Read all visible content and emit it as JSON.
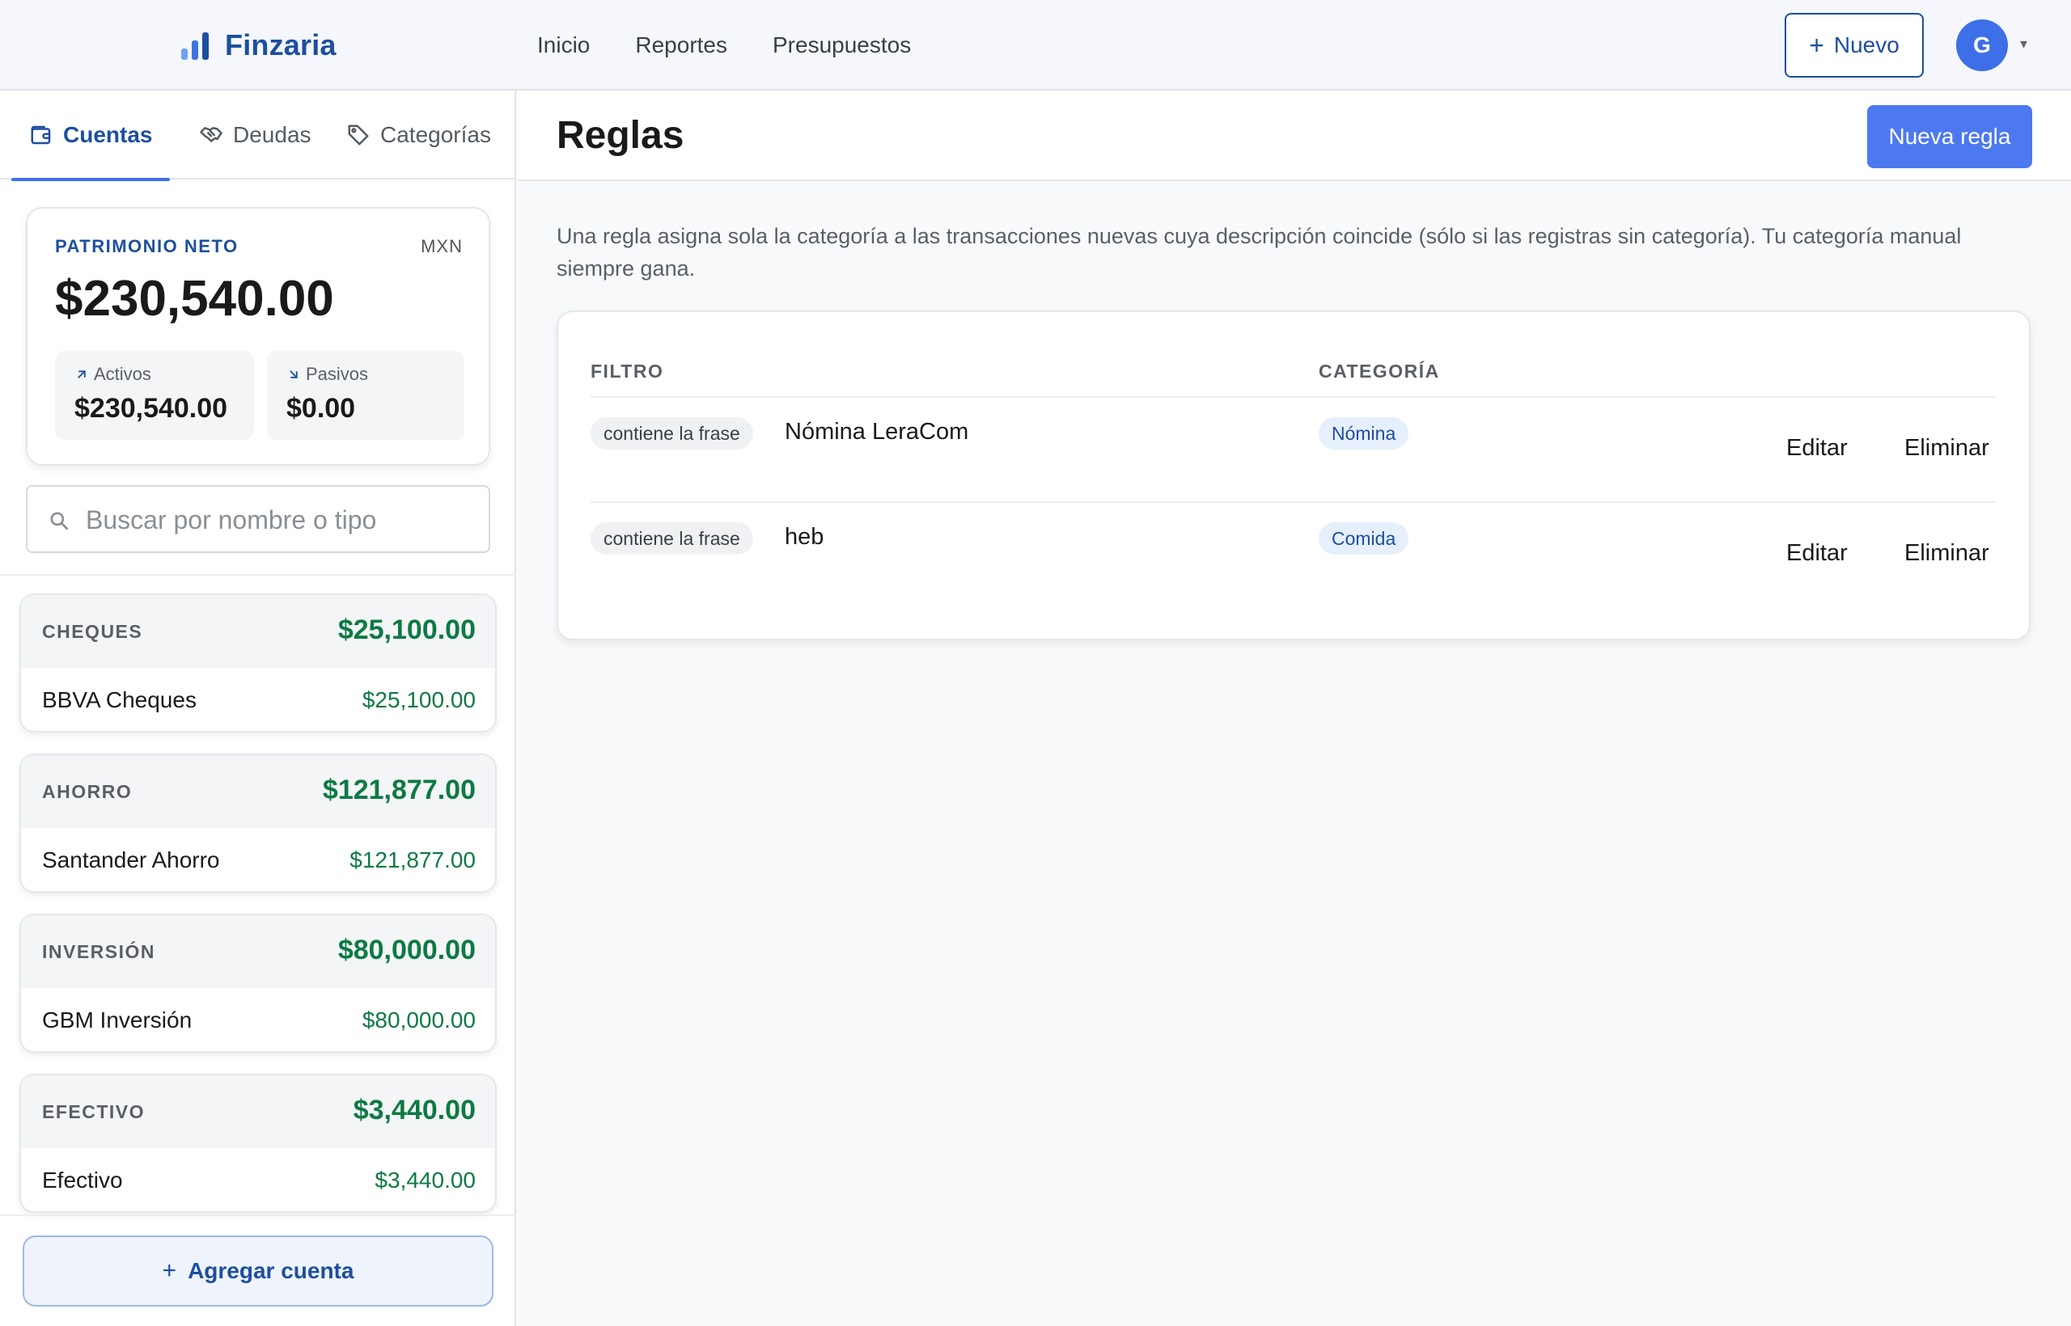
{
  "header": {
    "brand": "Finzaria",
    "nav": [
      "Inicio",
      "Reportes",
      "Presupuestos"
    ],
    "new_button": "Nuevo",
    "avatar_initial": "G"
  },
  "sidebar": {
    "tabs": [
      {
        "label": "Cuentas",
        "icon": "wallet-icon",
        "active": true
      },
      {
        "label": "Deudas",
        "icon": "handshake-icon",
        "active": false
      },
      {
        "label": "Categorías",
        "icon": "tag-icon",
        "active": false
      }
    ],
    "net_worth": {
      "label": "PATRIMONIO NETO",
      "currency": "MXN",
      "value": "$230,540.00",
      "assets_label": "Activos",
      "assets_value": "$230,540.00",
      "liabilities_label": "Pasivos",
      "liabilities_value": "$0.00"
    },
    "search_placeholder": "Buscar por nombre o tipo",
    "groups": [
      {
        "name": "CHEQUES",
        "total": "$25,100.00",
        "account": "BBVA Cheques",
        "account_value": "$25,100.00"
      },
      {
        "name": "AHORRO",
        "total": "$121,877.00",
        "account": "Santander Ahorro",
        "account_value": "$121,877.00"
      },
      {
        "name": "INVERSIÓN",
        "total": "$80,000.00",
        "account": "GBM Inversión",
        "account_value": "$80,000.00"
      },
      {
        "name": "EFECTIVO",
        "total": "$3,440.00",
        "account": "Efectivo",
        "account_value": "$3,440.00"
      }
    ],
    "add_account": "Agregar cuenta"
  },
  "main": {
    "title": "Reglas",
    "new_rule_button": "Nueva regla",
    "description": "Una regla asigna sola la categoría a las transacciones nuevas cuya descripción coincide (sólo si las registras sin categoría). Tu categoría manual siempre gana.",
    "table": {
      "headers": {
        "filter": "FILTRO",
        "category": "CATEGORÍA"
      },
      "rows": [
        {
          "match": "contiene la frase",
          "phrase": "Nómina LeraCom",
          "category": "Nómina",
          "edit": "Editar",
          "delete": "Eliminar"
        },
        {
          "match": "contiene la frase",
          "phrase": "heb",
          "category": "Comida",
          "edit": "Editar",
          "delete": "Eliminar"
        }
      ]
    }
  },
  "colors": {
    "brand": "#1d4f9f",
    "accent": "#4d79f0",
    "positive": "#0d7a43"
  }
}
